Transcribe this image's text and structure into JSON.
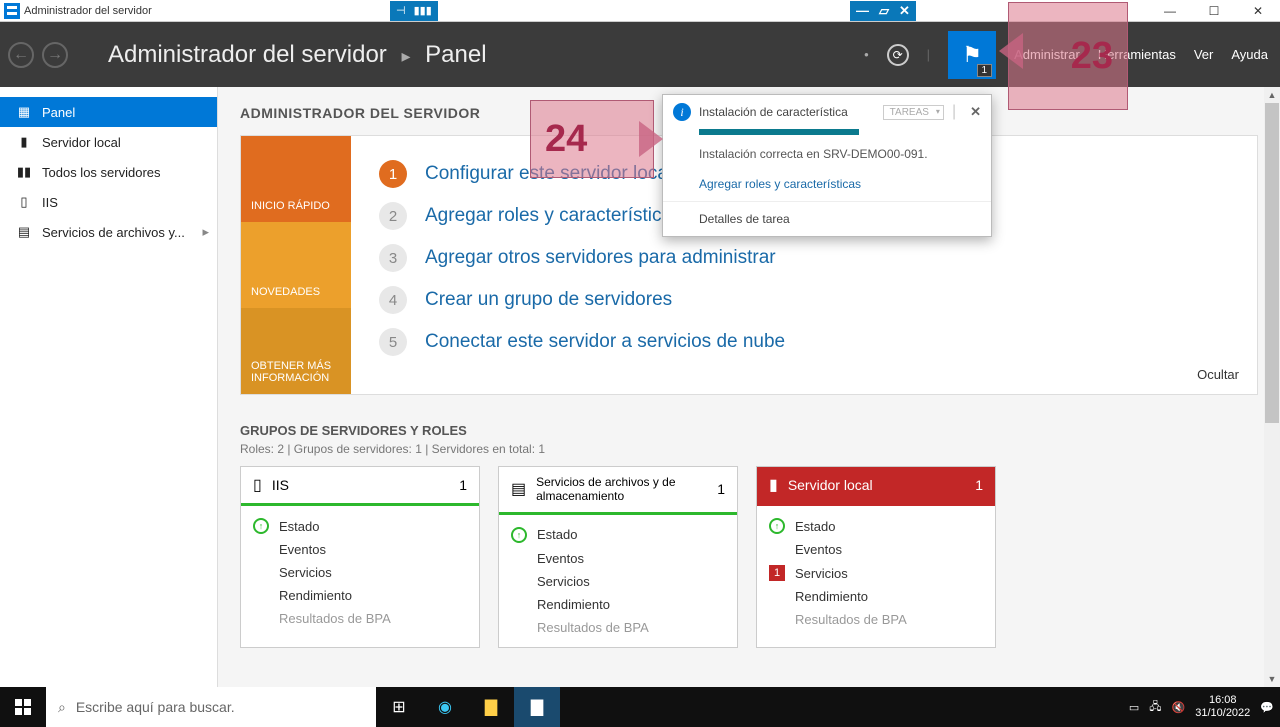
{
  "titlebar": {
    "title": "Administrador del servidor"
  },
  "header": {
    "breadcrumb_root": "Administrador del servidor",
    "breadcrumb_current": "Panel",
    "menu": {
      "administrar": "Administrar",
      "herramientas": "Herramientas",
      "ver": "Ver",
      "ayuda": "Ayuda"
    },
    "flag_badge": "1"
  },
  "sidebar": {
    "items": [
      {
        "label": "Panel"
      },
      {
        "label": "Servidor local"
      },
      {
        "label": "Todos los servidores"
      },
      {
        "label": "IIS"
      },
      {
        "label": "Servicios de archivos y..."
      }
    ]
  },
  "main": {
    "section_title": "ADMINISTRADOR DEL SERVIDOR",
    "sidetabs": {
      "quick": "INICIO RÁPIDO",
      "news": "NOVEDADES",
      "more": "OBTENER MÁS INFORMACIÓN"
    },
    "steps": [
      {
        "n": "1",
        "t": "Configurar este servidor local"
      },
      {
        "n": "2",
        "t": "Agregar roles y características"
      },
      {
        "n": "3",
        "t": "Agregar otros servidores para administrar"
      },
      {
        "n": "4",
        "t": "Crear un grupo de servidores"
      },
      {
        "n": "5",
        "t": "Conectar este servidor a servicios de nube"
      }
    ],
    "hide": "Ocultar",
    "groups_title": "GRUPOS DE SERVIDORES Y ROLES",
    "groups_sub": "Roles: 2   |   Grupos de servidores: 1   |   Servidores en total: 1",
    "tile_rows": {
      "estado": "Estado",
      "eventos": "Eventos",
      "servicios": "Servicios",
      "rendimiento": "Rendimiento",
      "bpa": "Resultados de BPA"
    },
    "tiles": [
      {
        "title": "IIS",
        "count": "1"
      },
      {
        "title": "Servicios de archivos y de almacenamiento",
        "count": "1"
      },
      {
        "title": "Servidor local",
        "count": "1"
      }
    ]
  },
  "notif": {
    "title": "Instalación de característica",
    "tareas": "TAREAS",
    "body": "Instalación correcta en SRV-DEMO00-091.",
    "link": "Agregar roles y características",
    "details": "Detalles de tarea"
  },
  "anno": {
    "a23": "23",
    "a24": "24"
  },
  "taskbar": {
    "search_placeholder": "Escribe aquí para buscar.",
    "time": "16:08",
    "date": "31/10/2022"
  }
}
